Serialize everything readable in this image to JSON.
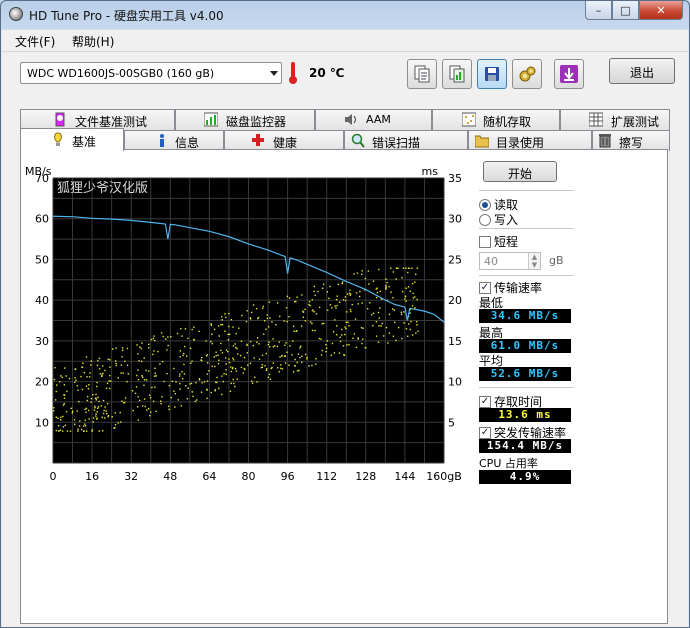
{
  "window": {
    "title": "HD Tune Pro - 硬盘实用工具 v4.00",
    "minimize": "–",
    "maximize": "□",
    "close": "✕"
  },
  "menu": [
    {
      "label": "文件(F)"
    },
    {
      "label": "帮助(H)"
    }
  ],
  "toolbar": {
    "drive": "WDC WD1600JS-00SGB0    (160 gB)",
    "temperature": "20 ℃",
    "exit_label": "退出",
    "buttons": [
      "copy-info-icon",
      "copy-results-icon",
      "save-icon",
      "options-icon",
      "download-icon"
    ]
  },
  "tabs_top": [
    {
      "label": "文件基准测试",
      "icon": "file-benchmark-icon"
    },
    {
      "label": "磁盘监控器",
      "icon": "disk-monitor-icon"
    },
    {
      "label": "AAM",
      "icon": "speaker-icon"
    },
    {
      "label": "随机存取",
      "icon": "random-access-icon"
    },
    {
      "label": "扩展测试",
      "icon": "extra-tests-icon"
    }
  ],
  "tabs_bottom": [
    {
      "label": "基准",
      "icon": "benchmark-icon",
      "selected": true
    },
    {
      "label": "信息",
      "icon": "info-icon"
    },
    {
      "label": "健康",
      "icon": "health-icon"
    },
    {
      "label": "错误扫描",
      "icon": "error-scan-icon"
    },
    {
      "label": "目录使用",
      "icon": "folder-usage-icon"
    },
    {
      "label": "擦写",
      "icon": "erase-icon"
    }
  ],
  "controls": {
    "start_label": "开始",
    "read_label": "读取",
    "write_label": "写入",
    "short_label": "短程",
    "short_value": "40",
    "short_unit": "gB",
    "transfer_label": "传输速率",
    "min_label": "最低",
    "min_value": "34.6 MB/s",
    "max_label": "最高",
    "max_value": "61.0 MB/s",
    "avg_label": "平均",
    "avg_value": "52.6 MB/s",
    "access_label": "存取时间",
    "access_value": "13.6 ms",
    "burst_label": "突发传输速率",
    "burst_value": "154.4 MB/s",
    "cpu_label": "CPU 占用率",
    "cpu_value": "4.9%"
  },
  "chart_data": {
    "type": "line",
    "watermark": "狐狸少爷汉化版",
    "ylabel_left": "MB/s",
    "ylabel_right": "ms",
    "ylim_left": [
      0,
      70
    ],
    "ylim_right": [
      0,
      35
    ],
    "yticks_left": [
      "70",
      "60",
      "50",
      "40",
      "30",
      "20",
      "10"
    ],
    "yticks_right": [
      "35",
      "30",
      "25",
      "20",
      "15",
      "10",
      "5"
    ],
    "xlim": [
      0,
      160
    ],
    "xticks": [
      "0",
      "16",
      "32",
      "48",
      "64",
      "80",
      "96",
      "112",
      "128",
      "144",
      "160gB"
    ],
    "grid": true,
    "series": [
      {
        "role": "transfer rate",
        "axis": "left",
        "color": "#4fb4ec",
        "x": [
          0,
          8,
          16,
          24,
          32,
          40,
          46,
          47,
          48,
          50,
          56,
          64,
          72,
          80,
          88,
          95,
          96,
          97,
          100,
          104,
          112,
          120,
          128,
          136,
          140,
          144,
          145,
          146,
          152,
          156,
          160
        ],
        "y": [
          60.6,
          60.5,
          60.1,
          59.9,
          59.6,
          59.1,
          58.7,
          55.0,
          58.6,
          58.5,
          57.8,
          56.9,
          55.6,
          53.8,
          52.3,
          50.7,
          46.5,
          50.4,
          49.8,
          48.8,
          46.8,
          44.6,
          42.6,
          40.0,
          38.9,
          38.3,
          35.0,
          38.0,
          37.3,
          36.5,
          34.6
        ]
      },
      {
        "role": "access time",
        "axis": "right",
        "type": "scatter",
        "color": "#e8e832",
        "x_range": [
          0,
          150
        ],
        "y_range_ms": [
          4,
          22
        ],
        "mean_ms": 13.6
      }
    ]
  }
}
